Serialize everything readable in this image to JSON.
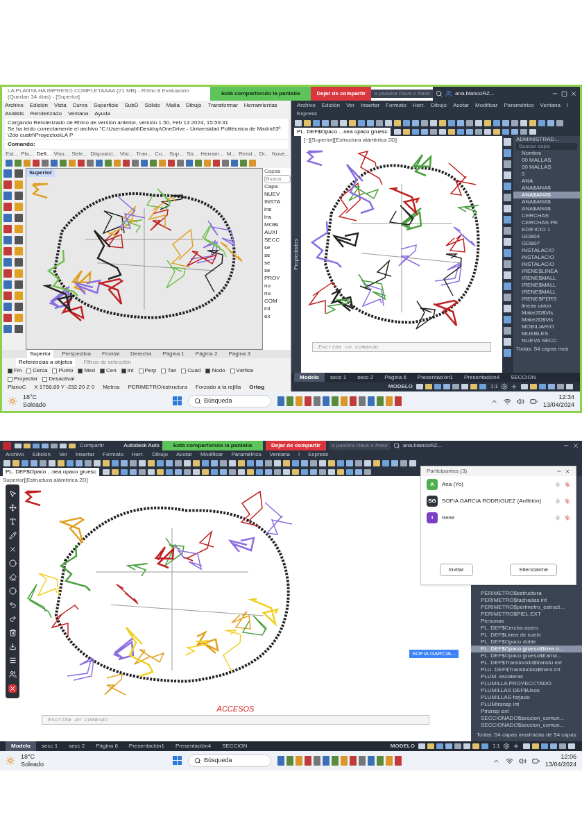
{
  "top": {
    "rhino": {
      "title": "LA PLANTA HA IMPRESO COMPLETAAAA (21 MB) - Rhino 8 Evaluación (Quedan 34 días) - [Superior]",
      "menu": [
        "Archivo",
        "Edición",
        "Vista",
        "Curva",
        "Superficie",
        "SubD",
        "Sólido",
        "Malla",
        "Dibujo",
        "Transformar",
        "Herramientas",
        "Análisis",
        "Renderizado",
        "Ventana",
        "Ayuda"
      ],
      "history": [
        "Cargando Renderizado de Rhino de versión anterior, versión 1.50, Feb 13 2024, 15:59:31",
        "Se ha leído correctamente el archivo \"C:\\Users\\anabl\\Desktop\\OneDrive - Universidad Politécnica de Madrid\\3º\\2do cuatri\\Proyectos\\LA P"
      ],
      "command_label": "Comando:",
      "toolbar_tabs": [
        {
          "label": "Est...",
          "selected": false
        },
        {
          "label": "Pla...",
          "selected": false
        },
        {
          "label": "Defi...",
          "selected": true
        },
        {
          "label": "Visu...",
          "selected": false
        },
        {
          "label": "Sele...",
          "selected": false
        },
        {
          "label": "Disposici...",
          "selected": false
        },
        {
          "label": "Visi...",
          "selected": false
        },
        {
          "label": "Tran...",
          "selected": false
        },
        {
          "label": "Cu...",
          "selected": false
        },
        {
          "label": "Sup...",
          "selected": false
        },
        {
          "label": "Só...",
          "selected": false
        },
        {
          "label": "Herram...",
          "selected": false
        },
        {
          "label": "M...",
          "selected": false
        },
        {
          "label": "Rend...",
          "selected": false
        },
        {
          "label": "Di...",
          "selected": false
        },
        {
          "label": "Nove...",
          "selected": false
        }
      ],
      "viewport_label": "Superior",
      "layers": {
        "title": "Capas",
        "search": "Busca",
        "header": "Capa",
        "items": [
          "NUEV",
          "INSTA",
          "ins",
          "ins",
          "MOBI",
          "AUXI",
          "SECC",
          "se",
          "se",
          "se",
          "se",
          "PROY",
          "nu",
          "nu",
          "COM",
          "int",
          "ex"
        ]
      },
      "view_tabs": [
        {
          "label": "Superior",
          "selected": true
        },
        {
          "label": "Perspectiva",
          "selected": false
        },
        {
          "label": "Frontal",
          "selected": false
        },
        {
          "label": "Derecha",
          "selected": false
        },
        {
          "label": "Página 1",
          "selected": false
        },
        {
          "label": "Página 2",
          "selected": false
        },
        {
          "label": "Página 3",
          "selected": false
        }
      ],
      "panel_tabs": [
        {
          "label": "Referencias a objetos",
          "selected": true
        },
        {
          "label": "Filtros de selección",
          "selected": false
        }
      ],
      "osnaps": [
        {
          "label": "Fin",
          "checked": true
        },
        {
          "label": "Cerca",
          "checked": false
        },
        {
          "label": "Punto",
          "checked": false
        },
        {
          "label": "Med",
          "checked": true
        },
        {
          "label": "Cen",
          "checked": true
        },
        {
          "label": "Int",
          "checked": true
        },
        {
          "label": "Perp",
          "checked": false
        },
        {
          "label": "Tan",
          "checked": false
        },
        {
          "label": "Cuad",
          "checked": false
        },
        {
          "label": "Nodo",
          "checked": true
        },
        {
          "label": "Vértice",
          "checked": false
        },
        {
          "label": "Proyectar",
          "checked": false
        },
        {
          "label": "Desactivar",
          "checked": false
        }
      ],
      "status": [
        "PlanoC",
        "X 1756.89 Y -232.20 Z 0",
        "Metros",
        "PERIMETRO/estructura",
        "Forzado a la rejilla",
        "Ortog"
      ]
    },
    "share": {
      "banner": "Está compartiendo la pantalla",
      "stop": "Dejar de compartir",
      "search": "a palabra clave o frase"
    },
    "autocad": {
      "user": "ana.blancoRZ...",
      "menu": [
        "Archivo",
        "Edición",
        "Ver",
        "Insertar",
        "Formato",
        "Herr.",
        "Dibujo",
        "Acotar",
        "Modificar",
        "Paramétrico",
        "Ventana",
        "!",
        "Express"
      ],
      "layer_combo": "PL. DEF$Opaco ...nea opaco gruesc",
      "viewport_label": "[−][Superior][Estructura alámbrica 2D]",
      "side_label": "Propiedades",
      "manager": {
        "title": "ADMINISTRAD...",
        "search": "Buscar capa",
        "header": "Nombre",
        "layers": [
          {
            "name": "00 MALLAS",
            "selected": false
          },
          {
            "name": "00 MALLAS",
            "selected": false
          },
          {
            "name": "0",
            "selected": false
          },
          {
            "name": "ANA",
            "selected": false
          },
          {
            "name": "ANA$ANA$",
            "selected": false
          },
          {
            "name": "ANA$ANA$",
            "selected": true
          },
          {
            "name": "ANA$ANA$",
            "selected": false
          },
          {
            "name": "ANA$ANA$",
            "selected": false
          },
          {
            "name": "CERCHAS",
            "selected": false
          },
          {
            "name": "CERCHAS PE",
            "selected": false
          },
          {
            "name": "EDIFICIO 1",
            "selected": false
          },
          {
            "name": "GDB04",
            "selected": false
          },
          {
            "name": "GDB07",
            "selected": false
          },
          {
            "name": "INSTALACIO",
            "selected": false
          },
          {
            "name": "INSTALACIO",
            "selected": false
          },
          {
            "name": "INSTALACIO",
            "selected": false
          },
          {
            "name": "IRENE$LINEA",
            "selected": false
          },
          {
            "name": "IRENE$MALL",
            "selected": false
          },
          {
            "name": "IRENE$MALL",
            "selected": false
          },
          {
            "name": "IRENE$MALL",
            "selected": false
          },
          {
            "name": "IRENE$PERS",
            "selected": false
          },
          {
            "name": "lineas union",
            "selected": false
          },
          {
            "name": "Make2D$Vis",
            "selected": false
          },
          {
            "name": "Make2D$Vis",
            "selected": false
          },
          {
            "name": "MOBILIARIO",
            "selected": false
          },
          {
            "name": "MUEBLES",
            "selected": false
          },
          {
            "name": "NUEVA SECC",
            "selected": false
          }
        ],
        "footer": "Todas: 54 capas mos"
      },
      "command_placeholder": "Escriba un comando",
      "layout_tabs": [
        {
          "label": "Modelo",
          "selected": true
        },
        {
          "label": "secc 1",
          "selected": false
        },
        {
          "label": "secc 2",
          "selected": false
        },
        {
          "label": "Página 6",
          "selected": false
        },
        {
          "label": "Presentación1",
          "selected": false
        },
        {
          "label": "Presentación4",
          "selected": false
        },
        {
          "label": "SECCION",
          "selected": false
        }
      ],
      "model": "MODELO",
      "scale": "1:1"
    },
    "taskbar": {
      "temp": "18°C",
      "weather": "Soleado",
      "search": "Búsqueda",
      "time": "12:34",
      "date": "13/04/2024"
    }
  },
  "bottom": {
    "autocad": {
      "share_label": "Compartir",
      "title": "Autodesk Auto",
      "user": "ana.blancoRZ...",
      "menu": [
        "Archivo",
        "Edición",
        "Ver",
        "Insertar",
        "Formato",
        "Herr.",
        "Dibujo",
        "Acotar",
        "Modificar",
        "Paramétrico",
        "Ventana",
        "!",
        "Express"
      ],
      "layer_combo": "PL. DEF$Opaco ...nea opaco gruesc",
      "viewport_label": "Superior][Estructura alámbrica 2D]",
      "cursor_label": "SOFIA GARCIA...",
      "annotation": "ACCESOS",
      "layers": [
        {
          "name": "PERIMETRO$estructura",
          "selected": false
        },
        {
          "name": "PERIMETRO$fachadas int",
          "selected": false
        },
        {
          "name": "PERIMETRO$perimetro_estruct...",
          "selected": false
        },
        {
          "name": "PERIMETRO$PIEL EXT",
          "selected": false
        },
        {
          "name": "Personas",
          "selected": false
        },
        {
          "name": "PL. DEF$Cercha acero",
          "selected": false
        },
        {
          "name": "PL. DEF$Linea de suelo",
          "selected": false
        },
        {
          "name": "PL. DEF$Opaco doble",
          "selected": false
        },
        {
          "name": "PL. DEF$Opaco grueso$linea o...",
          "selected": true
        },
        {
          "name": "PL. DEF$Opaco grueso$trama...",
          "selected": false
        },
        {
          "name": "PL. DEF$Translúcido$translu ext",
          "selected": false
        },
        {
          "name": "PLU. DEF$Translúcido$trans int",
          "selected": false
        },
        {
          "name": "PLUM. escaleras",
          "selected": false
        },
        {
          "name": "PLUMILLA PROYECCTADO",
          "selected": false
        },
        {
          "name": "PLUMILLAS DEF$Usos",
          "selected": false
        },
        {
          "name": "PLUMILLAS forjado",
          "selected": false
        },
        {
          "name": "PLUMtransp int",
          "selected": false
        },
        {
          "name": "Ptransp ext",
          "selected": false
        },
        {
          "name": "SECCIONADO$seccion_comun...",
          "selected": false
        },
        {
          "name": "SECCIONADO$seccion_comun...",
          "selected": false
        }
      ],
      "footer": "Todas: 54 capas mostradas de 54 capas",
      "command_placeholder": "Escriba un comando",
      "layout_tabs": [
        {
          "label": "Modelo",
          "selected": true
        },
        {
          "label": "secc 1",
          "selected": false
        },
        {
          "label": "secc 2",
          "selected": false
        },
        {
          "label": "Página 6",
          "selected": false
        },
        {
          "label": "Presentación1",
          "selected": false
        },
        {
          "label": "Presentación4",
          "selected": false
        },
        {
          "label": "SECCION",
          "selected": false
        }
      ],
      "model": "MODELO",
      "scale": "1:1"
    },
    "share": {
      "banner": "Está compartiendo la pantalla",
      "stop": "Dejar de compartir",
      "search": "a palabra clave o frase"
    },
    "participants": {
      "title": "Participantes (3)",
      "people": [
        {
          "initials": "A",
          "name": "Ana (Yo)",
          "color": "#4caf50"
        },
        {
          "initials": "SG",
          "name": "SOFIA GARCIA RODRIGUEZ (Anfitrión)",
          "color": "#2f3440"
        },
        {
          "initials": "I",
          "name": "Irene",
          "color": "#7b3fc4"
        }
      ],
      "buttons": [
        "Invitar",
        "Silenciarme"
      ]
    },
    "taskbar": {
      "temp": "18°C",
      "weather": "Soleado",
      "search": "Búsqueda",
      "time": "12:06",
      "date": "13/04/2024"
    }
  }
}
